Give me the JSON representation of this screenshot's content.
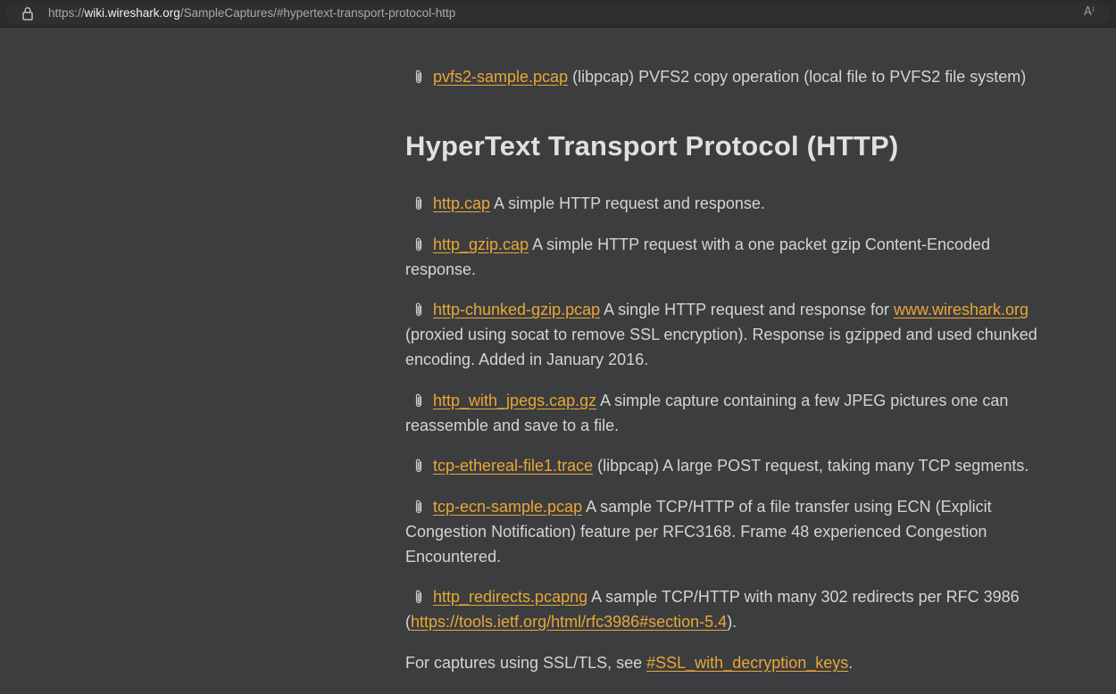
{
  "browser": {
    "url_scheme": "https://",
    "url_host": "wiki.wireshark.org",
    "url_path": "/SampleCaptures/#hypertext-transport-protocol-http",
    "read_aloud_icon": "A⁾"
  },
  "prev_section": {
    "item": {
      "link": "pvfs2-sample.pcap",
      "text": " (libpcap) PVFS2 copy operation (local file to PVFS2 file system)"
    }
  },
  "section": {
    "title": "HyperText Transport Protocol (HTTP)",
    "items": [
      {
        "link": "http.cap",
        "text": " A simple HTTP request and response."
      },
      {
        "link": "http_gzip.cap",
        "text": " A simple HTTP request with a one packet gzip Content-Encoded response."
      },
      {
        "link": "http-chunked-gzip.pcap",
        "text": " A single HTTP request and response for ",
        "link2": "www.wireshark.org",
        "text2": " (proxied using socat to remove SSL encryption). Response is gzipped and used chunked encoding. Added in January 2016."
      },
      {
        "link": "http_with_jpegs.cap.gz",
        "text": " A simple capture containing a few JPEG pictures one can reassemble and save to a file."
      },
      {
        "link": "tcp-ethereal-file1.trace",
        "text": " (libpcap) A large POST request, taking many TCP segments."
      },
      {
        "link": "tcp-ecn-sample.pcap",
        "text": " A sample TCP/HTTP of a file transfer using ECN (Explicit Congestion Notification) feature per RFC3168. Frame 48 experienced Congestion Encountered."
      },
      {
        "link": "http_redirects.pcapng",
        "text": " A sample TCP/HTTP with many 302 redirects per RFC 3986 (",
        "link2": "https://tools.ietf.org/html/rfc3986#section-5.4",
        "text2": ")."
      }
    ],
    "footer": {
      "text": "For captures using SSL/TLS, see ",
      "link": "#SSL_with_decryption_keys",
      "text2": "."
    }
  },
  "colors": {
    "background": "#3c3d3f",
    "link": "#e9a736",
    "text": "#d4d4d4",
    "heading": "#e0e0e0"
  }
}
